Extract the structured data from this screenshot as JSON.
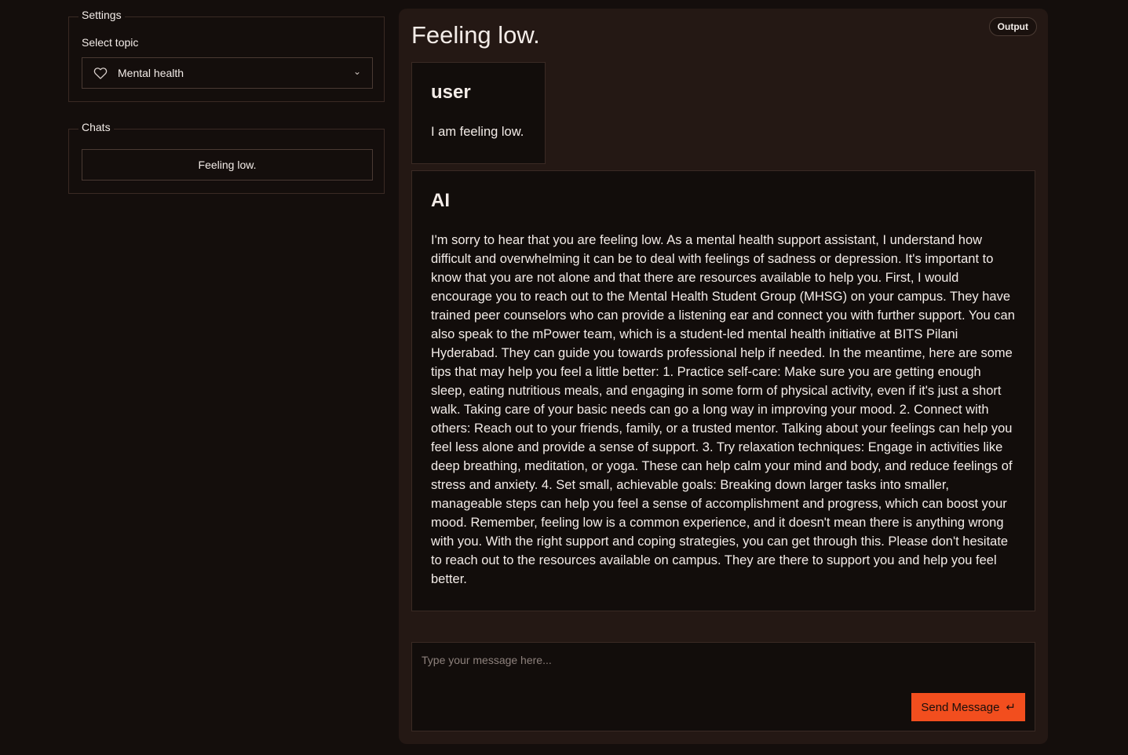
{
  "sidebar": {
    "settings": {
      "legend": "Settings",
      "topic_label": "Select topic",
      "topic_value": "Mental health",
      "topic_icon": "heart-icon"
    },
    "chats": {
      "legend": "Chats",
      "items": [
        "Feeling low."
      ]
    }
  },
  "main": {
    "badge": "Output",
    "title": "Feeling low.",
    "messages": [
      {
        "role": "user",
        "text": "I am feeling low."
      },
      {
        "role": "AI",
        "text": "I'm sorry to hear that you are feeling low. As a mental health support assistant, I understand how difficult and overwhelming it can be to deal with feelings of sadness or depression. It's important to know that you are not alone and that there are resources available to help you. First, I would encourage you to reach out to the Mental Health Student Group (MHSG) on your campus. They have trained peer counselors who can provide a listening ear and connect you with further support. You can also speak to the mPower team, which is a student-led mental health initiative at BITS Pilani Hyderabad. They can guide you towards professional help if needed. In the meantime, here are some tips that may help you feel a little better: 1. Practice self-care: Make sure you are getting enough sleep, eating nutritious meals, and engaging in some form of physical activity, even if it's just a short walk. Taking care of your basic needs can go a long way in improving your mood. 2. Connect with others: Reach out to your friends, family, or a trusted mentor. Talking about your feelings can help you feel less alone and provide a sense of support. 3. Try relaxation techniques: Engage in activities like deep breathing, meditation, or yoga. These can help calm your mind and body, and reduce feelings of stress and anxiety. 4. Set small, achievable goals: Breaking down larger tasks into smaller, manageable steps can help you feel a sense of accomplishment and progress, which can boost your mood. Remember, feeling low is a common experience, and it doesn't mean there is anything wrong with you. With the right support and coping strategies, you can get through this. Please don't hesitate to reach out to the resources available on campus. They are there to support you and help you feel better."
      }
    ],
    "composer": {
      "placeholder": "Type your message here...",
      "value": "",
      "send_label": "Send Message",
      "send_icon": "enter-icon"
    }
  },
  "colors": {
    "background": "#140e0c",
    "panel": "#241814",
    "accent": "#f24e1e"
  }
}
